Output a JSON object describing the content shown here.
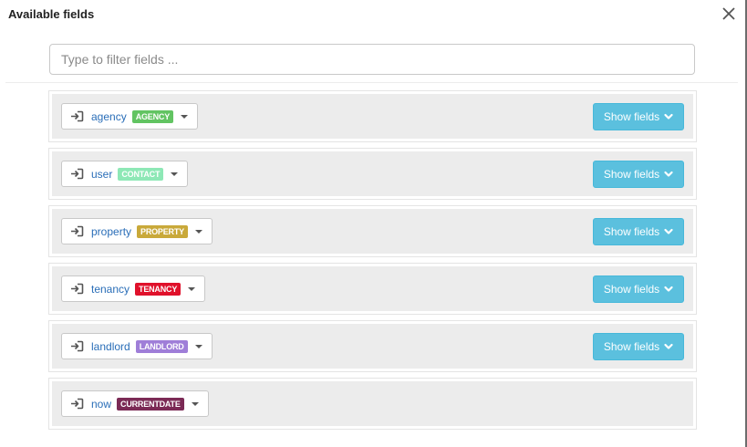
{
  "dialog": {
    "title": "Available fields",
    "filter_placeholder": "Type to filter fields ..."
  },
  "colors": {
    "agency": "#62c462",
    "contact": "#8ee8b6",
    "property": "#c9a93a",
    "tenancy": "#e0112b",
    "landlord": "#9f7ed8",
    "currentdate": "#7b2a55",
    "button": "#5bc0de"
  },
  "rows": [
    {
      "name": "agency",
      "badge": "AGENCY",
      "color_key": "agency",
      "button": "Show fields"
    },
    {
      "name": "user",
      "badge": "CONTACT",
      "color_key": "contact",
      "button": "Show fields"
    },
    {
      "name": "property",
      "badge": "PROPERTY",
      "color_key": "property",
      "button": "Show fields"
    },
    {
      "name": "tenancy",
      "badge": "TENANCY",
      "color_key": "tenancy",
      "button": "Show fields"
    },
    {
      "name": "landlord",
      "badge": "LANDLORD",
      "color_key": "landlord",
      "button": "Show fields"
    },
    {
      "name": "now",
      "badge": "CURRENTDATE",
      "color_key": "currentdate",
      "button": null
    }
  ],
  "icons": {
    "entity": "login-icon",
    "close": "close-icon",
    "button_chevron": "chevron-down-icon",
    "dropdown": "caret-down-icon"
  }
}
